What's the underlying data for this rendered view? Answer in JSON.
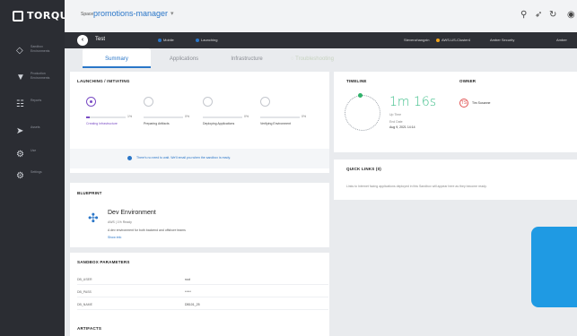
{
  "app": {
    "name": "TORQUE"
  },
  "sidebar": {
    "items": [
      {
        "icon": "diamond-icon",
        "label": "Sandbox Environments"
      },
      {
        "icon": "funnel-icon",
        "label": "Production Environments"
      },
      {
        "icon": "reports-icon",
        "label": "Reports"
      },
      {
        "icon": "rocket-icon",
        "label": "Assets"
      },
      {
        "icon": "cog-icon",
        "label": "Use"
      },
      {
        "icon": "settings-icon",
        "label": "Settings"
      }
    ]
  },
  "topbar": {
    "space_label": "Space",
    "space_value": "promotions-manager",
    "icons": [
      "search-icon",
      "send-icon",
      "refresh-icon",
      "user-icon"
    ]
  },
  "envbar": {
    "name": "Test",
    "mode": "Mobile",
    "status": "Launching",
    "owner": "Stevenzhangxin",
    "region": "AWS-US-Cluster4",
    "action1": "Amber Security",
    "action2": "Amber"
  },
  "tabs": [
    {
      "label": "Summary",
      "state": "active"
    },
    {
      "label": "Applications",
      "state": "normal"
    },
    {
      "label": "Infrastructure",
      "state": "normal"
    },
    {
      "label": "Troubleshooting",
      "state": "disabled"
    }
  ],
  "launching": {
    "title": "LAUNCHING / INITIATING",
    "steps": [
      {
        "name": "Creating Infrastructure",
        "pct": "1%",
        "progress": 0.1,
        "active": true
      },
      {
        "name": "Preparing Artifacts",
        "pct": "0%",
        "progress": 0,
        "active": false
      },
      {
        "name": "Deploying Applications",
        "pct": "0%",
        "progress": 0,
        "active": false
      },
      {
        "name": "Verifying Environment",
        "pct": "0%",
        "progress": 0,
        "active": false
      }
    ],
    "notice": "There's no need to wait. We'll email you when the sandbox is ready."
  },
  "timeline": {
    "title": "TIMELINE",
    "elapsed": "1m 16s",
    "elapsed_label": "Up Time",
    "end_label": "End Date",
    "end_value": "Aug 9, 2021 14:14"
  },
  "owner": {
    "title": "OWNER",
    "name": "Tim Susanne",
    "initials": "TS"
  },
  "quick_links": {
    "title": "QUICK LINKS (0)",
    "text": "Links to Internet facing applications deployed in this Sandbox will appear here as they become ready."
  },
  "blueprint": {
    "title": "BLUEPRINT",
    "name": "Dev Environment",
    "meta": "AWS | 1% Ready",
    "desc": "A dev environment for both backend and offshore teams",
    "more": "Show info"
  },
  "params": {
    "title": "SANDBOX PARAMETERS",
    "rows": [
      {
        "key": "DB_USER",
        "value": "root"
      },
      {
        "key": "DB_PASS",
        "value": "*****"
      },
      {
        "key": "DB_NAME",
        "value": "DB101_25"
      }
    ]
  },
  "artifacts": {
    "title": "ARTIFACTS"
  },
  "colors": {
    "accent": "#2a76c8",
    "sidebar": "#2b2d33",
    "progress": "#7a4cc4",
    "timer": "#3fbf8a",
    "promo": "#1f9ae3"
  }
}
